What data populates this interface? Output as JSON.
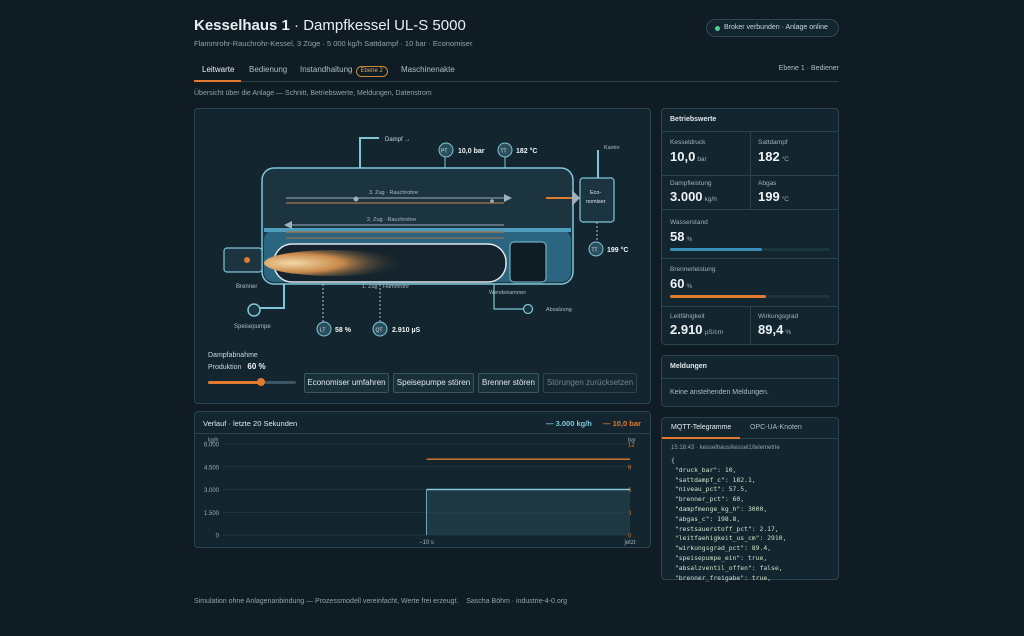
{
  "header": {
    "title_bold": "Kesselhaus 1",
    "title_rest": " · Dampfkessel UL-S 5000",
    "subtitle": "Flammrohr-Rauchrohr-Kessel, 3 Züge · 5 000 kg/h Sattdampf · 10 bar · Economiser",
    "status": "Broker verbunden · Anlage online",
    "status_color": "#4fd18b"
  },
  "tabs": {
    "items": [
      "Leitwarte",
      "Bedienung",
      "Instandhaltung",
      "Maschinenakte"
    ],
    "badge": "Ebene 2",
    "active": "Leitwarte",
    "level": "Ebene 1 · Bediener"
  },
  "overview_text": "Übersicht über die Anlage — Schnitt, Betriebswerte, Meldungen, Datenstrom",
  "diagram": {
    "dampf_label": "Dampf →",
    "kamin_label": "Kamin",
    "pt_tag": "PT",
    "pt_value": "10,0 bar",
    "tt1_tag": "TT",
    "tt1_value": "182 °C",
    "zug3": "3. Zug · Rauchrohre",
    "zug2": "2. Zug · Rauchrohre",
    "zug1": "1. Zug · Flammrohr",
    "economiser": "Eco-\nnomiser",
    "economiser_l1": "Eco-",
    "economiser_l2": "nomiser",
    "tt2_tag": "TT",
    "tt2_value": "199 °C",
    "brenner": "Brenner",
    "wendekammer": "Wendekammer",
    "speisepumpe": "Speisepumpe",
    "absalzung": "Absalzung",
    "lt_tag": "LT",
    "lt_value": "58 %",
    "qt_tag": "QT",
    "qt_value": "2.910 µS"
  },
  "controls": {
    "dampfabnahme": "Dampfabnahme",
    "produktion_label": "Produktion",
    "produktion_value": "60 %",
    "slider_value_pct": 60,
    "buttons": [
      "Economiser umfahren",
      "Speisepumpe stören",
      "Brenner stören",
      "Störungen zurücksetzen"
    ]
  },
  "chart_panel": {
    "title": "Verlauf · letzte 20 Sekunden",
    "legend_flow": "3.000 kg/h",
    "legend_pressure": "10,0 bar"
  },
  "chart_data": {
    "type": "line",
    "x_ticks": [
      "−10 s",
      "jetzt"
    ],
    "y_left_unit": "kg/h",
    "y_left_ticks": [
      "6.000",
      "4.500",
      "3.000",
      "1.500",
      "0"
    ],
    "y_left_range": [
      0,
      6000
    ],
    "y_right_unit": "bar",
    "y_right_ticks": [
      "12",
      "9",
      "6",
      "3",
      "0"
    ],
    "y_right_range": [
      0,
      12
    ],
    "series": [
      {
        "name": "Dampfleistung",
        "axis": "left",
        "color": "#7fc6d8",
        "x": [
          -10,
          0
        ],
        "values": [
          3000,
          3000
        ]
      },
      {
        "name": "Kesseldruck",
        "axis": "right",
        "color": "#e07a2e",
        "x": [
          -10,
          0
        ],
        "values": [
          10.0,
          10.0
        ]
      }
    ]
  },
  "betriebswerte": {
    "title": "Betriebswerte",
    "kesseldruck_label": "Kesseldruck",
    "kesseldruck_value": "10,0",
    "kesseldruck_unit": "bar",
    "sattdampf_label": "Sattdampf",
    "sattdampf_value": "182",
    "sattdampf_unit": "°C",
    "dampfleistung_label": "Dampfleistung",
    "dampfleistung_value": "3.000",
    "dampfleistung_unit": "kg/h",
    "abgas_label": "Abgas",
    "abgas_value": "199",
    "abgas_unit": "°C",
    "wasserstand_label": "Wasserstand",
    "wasserstand_value": "58",
    "wasserstand_unit": "%",
    "wasserstand_pct": 57.5,
    "wasserstand_color": "#3b8fb8",
    "brenner_label": "Brennerleistung",
    "brenner_value": "60",
    "brenner_unit": "%",
    "brenner_pct": 60,
    "brenner_color": "#e07a2e",
    "leitfaehigkeit_label": "Leitfähigkeit",
    "leitfaehigkeit_value": "2.910",
    "leitfaehigkeit_unit": "µS/cm",
    "wirkungsgrad_label": "Wirkungsgrad",
    "wirkungsgrad_value": "89,4",
    "wirkungsgrad_unit": "%"
  },
  "meldungen": {
    "title": "Meldungen",
    "text": "Keine anstehenden Meldungen."
  },
  "telegramme": {
    "tab_mqtt": "MQTT-Telegramme",
    "tab_opc": "OPC-UA-Knoten",
    "header": "15:18:43 · kesselhaus/kessel1/telemetrie",
    "lines": [
      "{",
      " \"druck_bar\": 10,",
      " \"sattdampf_c\": 182.1,",
      " \"niveau_pct\": 57.5,",
      " \"brenner_pct\": 60,",
      " \"dampfmenge_kg_h\": 3000,",
      " \"abgas_c\": 198.8,",
      " \"restsauerstoff_pct\": 2.17,",
      " \"leitfaehigkeit_us_cm\": 2910,",
      " \"wirkungsgrad_pct\": 89.4,",
      " \"speisepumpe_ein\": true,",
      " \"absalzventil_offen\": false,",
      " \"brenner_freigabe\": true,"
    ]
  },
  "footer": "Simulation ohne Anlagenanbindung — Prozessmodell vereinfacht, Werte frei erzeugt.    Sascha Böhm · industrie-4-0.org"
}
